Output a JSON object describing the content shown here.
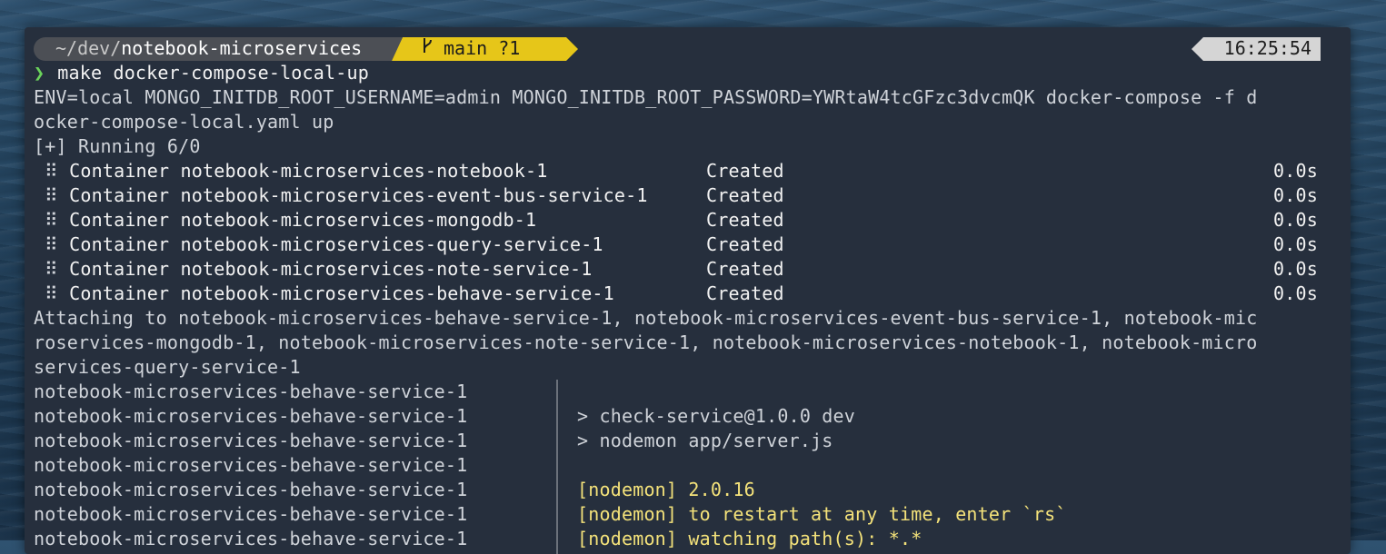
{
  "prompt": {
    "path_prefix": "~/dev/",
    "path_dir": "notebook-microservices",
    "branch": "main ?1",
    "time": "16:25:54",
    "arrow": "❯",
    "command": "make docker-compose-local-up"
  },
  "output": {
    "env_line_1": "ENV=local MONGO_INITDB_ROOT_USERNAME=admin MONGO_INITDB_ROOT_PASSWORD=YWRtaW4tcGFzc3dvcmQK docker-compose -f d",
    "env_line_2": "ocker-compose-local.yaml up",
    "running": "[+] Running 6/0",
    "containers": [
      {
        "dots": "⠿",
        "name": "Container notebook-microservices-notebook-1",
        "status": "Created",
        "time": "0.0s"
      },
      {
        "dots": "⠿",
        "name": "Container notebook-microservices-event-bus-service-1",
        "status": "Created",
        "time": "0.0s"
      },
      {
        "dots": "⠿",
        "name": "Container notebook-microservices-mongodb-1",
        "status": "Created",
        "time": "0.0s"
      },
      {
        "dots": "⠿",
        "name": "Container notebook-microservices-query-service-1",
        "status": "Created",
        "time": "0.0s"
      },
      {
        "dots": "⠿",
        "name": "Container notebook-microservices-note-service-1",
        "status": "Created",
        "time": "0.0s"
      },
      {
        "dots": "⠿",
        "name": "Container notebook-microservices-behave-service-1",
        "status": "Created",
        "time": "0.0s"
      }
    ],
    "attach_1": "Attaching to notebook-microservices-behave-service-1, notebook-microservices-event-bus-service-1, notebook-mic",
    "attach_2": "roservices-mongodb-1, notebook-microservices-note-service-1, notebook-microservices-notebook-1, notebook-micro",
    "attach_3": "services-query-service-1",
    "log_rows": [
      {
        "source": "notebook-microservices-behave-service-1",
        "message": ""
      },
      {
        "source": "notebook-microservices-behave-service-1",
        "message": "> check-service@1.0.0 dev"
      },
      {
        "source": "notebook-microservices-behave-service-1",
        "message": "> nodemon app/server.js"
      },
      {
        "source": "notebook-microservices-behave-service-1",
        "message": ""
      },
      {
        "source": "notebook-microservices-behave-service-1",
        "message": "[nodemon] 2.0.16"
      },
      {
        "source": "notebook-microservices-behave-service-1",
        "message": "[nodemon] to restart at any time, enter `rs`"
      },
      {
        "source": "notebook-microservices-behave-service-1",
        "message": "[nodemon] watching path(s): *.*"
      }
    ]
  },
  "colors": {
    "terminal_bg": "#262f3d",
    "path_segment": "#4c4f55",
    "git_segment": "#e6c619",
    "time_segment": "#d5d5d5",
    "prompt_arrow": "#6bd35b",
    "nodemon_text": "#f4e27a"
  }
}
